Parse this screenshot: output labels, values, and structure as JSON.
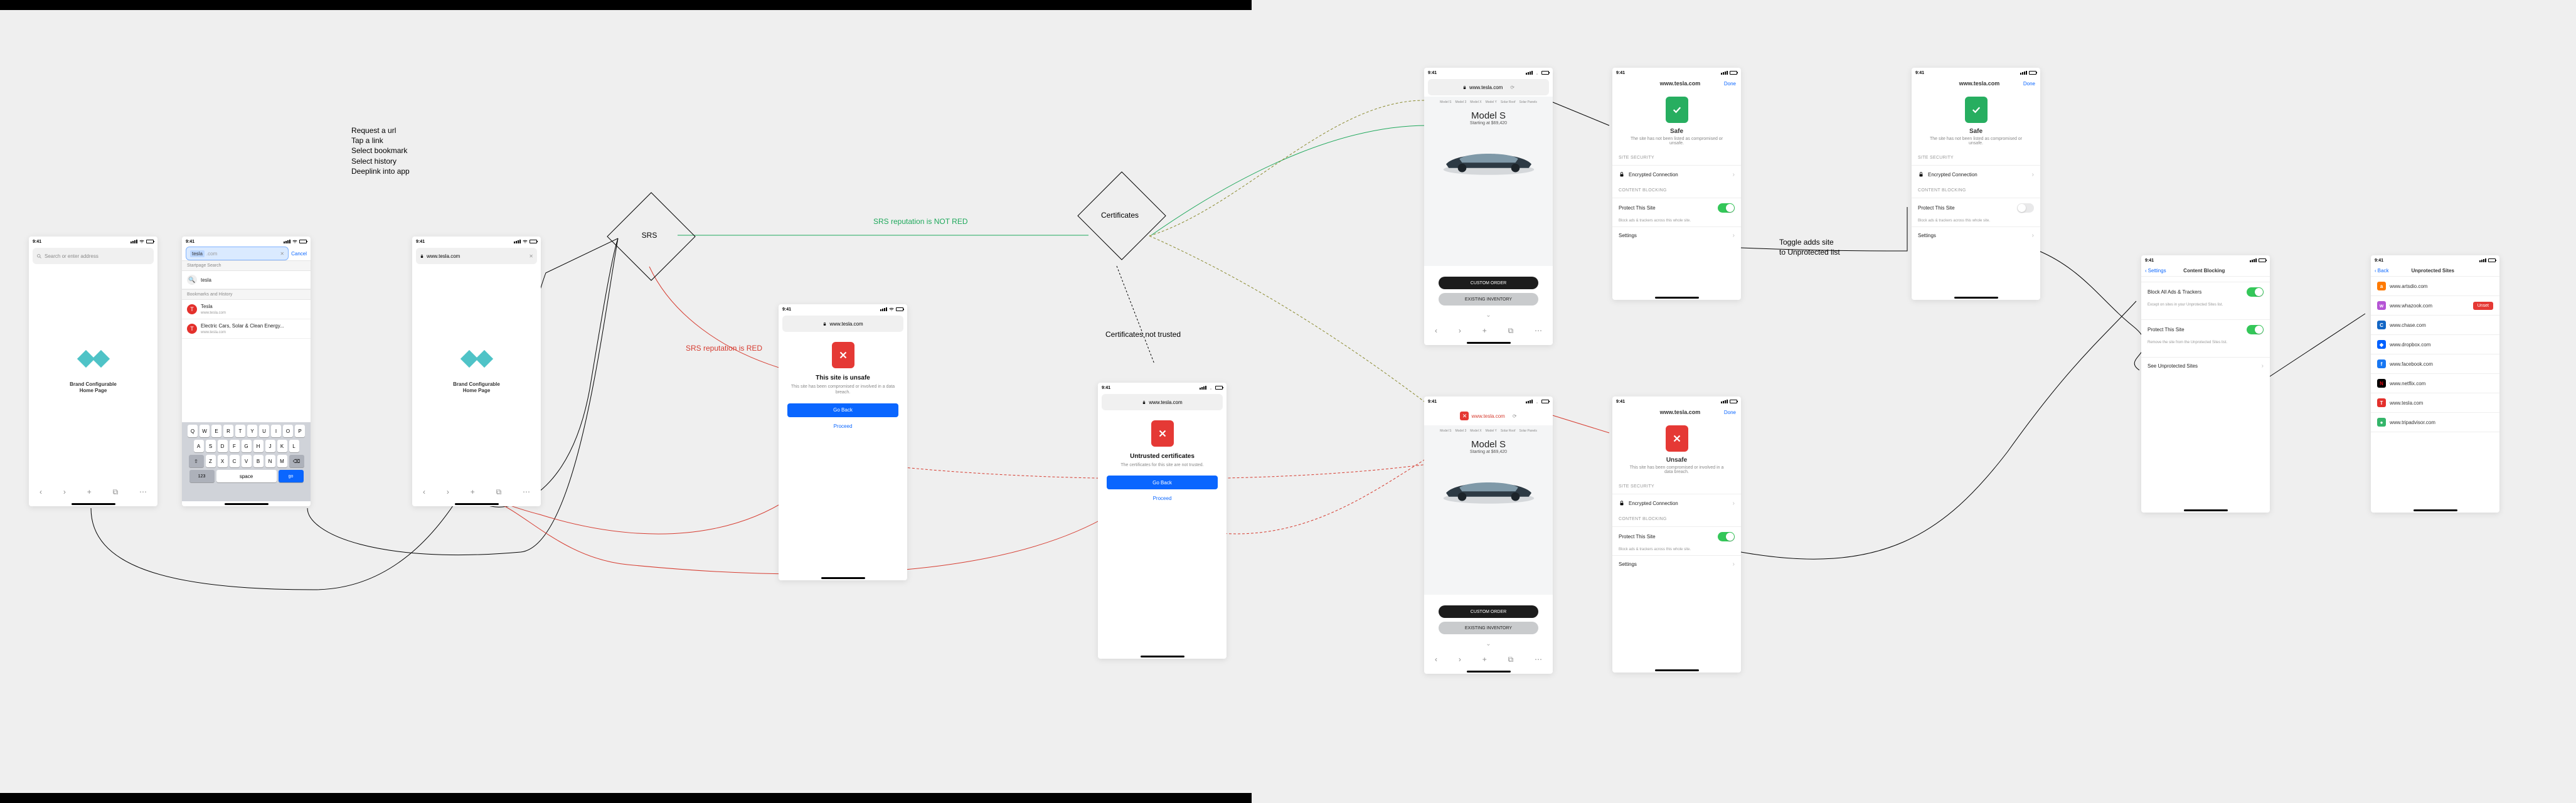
{
  "statusbar": {
    "time": "9:41"
  },
  "url_placeholder": "Search or enter address",
  "url_tesla": "www.tesla.com",
  "url_red_tesla": "www.tesla.com",
  "home_caption_line1": "Brand Configurable",
  "home_caption_line2": "Home Page",
  "toolbar": {
    "back": "‹",
    "forward": "›",
    "plus": "+",
    "tabs": "⧉",
    "more": "⋯"
  },
  "note_actions_1": "Request a url",
  "note_actions_2": "Tap a link",
  "note_actions_3": "Select bookmark",
  "note_actions_4": "Select history",
  "note_actions_5": "Deeplink into app",
  "cancel_label": "Cancel",
  "typed_query": "tesla",
  "suggest": {
    "sect1": "Startpage Search",
    "r1": "tesla",
    "sect2": "Bookmarks and History",
    "r2": "Tesla",
    "r2sub": "www.tesla.com",
    "r3": "Electric Cars, Solar & Clean Energy...",
    "r3sub": "www.tesla.com"
  },
  "keyboard": {
    "row1": [
      "Q",
      "W",
      "E",
      "R",
      "T",
      "Y",
      "U",
      "I",
      "O",
      "P"
    ],
    "row2": [
      "A",
      "S",
      "D",
      "F",
      "G",
      "H",
      "J",
      "K",
      "L"
    ],
    "row3": [
      "Z",
      "X",
      "C",
      "V",
      "B",
      "N",
      "M"
    ],
    "shift": "⇧",
    "del": "⌫",
    "num": "123",
    "space": "space",
    "go": "go"
  },
  "srs_label": "SRS",
  "srs_green": "SRS reputation is NOT RED",
  "srs_red": "SRS reputation is RED",
  "cert_label": "Certificates",
  "cert_not_trusted": "Certificates not trusted",
  "unsafe_title": "This site is unsafe",
  "unsafe_sub": "This site has been compromised or involved in a data breach.",
  "go_back": "Go Back",
  "proceed": "Proceed",
  "untrusted_title": "Untrusted certificates",
  "untrusted_sub": "The certificates for this site are not trusted.",
  "carpage": {
    "tabs": [
      "Model S",
      "Model 3",
      "Model X",
      "Model Y",
      "Solar Roof",
      "Solar Panels"
    ],
    "title": "Model S",
    "subtitle": "Starting at $69,420",
    "cta1": "CUSTOM ORDER",
    "cta2": "EXISTING INVENTORY"
  },
  "panel": {
    "done": "Done",
    "safe_title": "Safe",
    "safe_sub": "The site has not been listed as compromised or unsafe.",
    "unsafe_title": "Unsafe",
    "unsafe_sub": "This site has been compromised or involved in a data breach.",
    "sect_site": "SITE SECURITY",
    "encrypted": "Encrypted Connection",
    "sect_cb": "CONTENT BLOCKING",
    "protect": "Protect This Site",
    "protect_sub": "Block ads & trackers across this whole site.",
    "settings": "Settings"
  },
  "toggle_note_1": "Toggle adds site",
  "toggle_note_2": "to Unprotected list",
  "settings_back": "Settings",
  "settings_title": "Content Blocking",
  "settings_block_all": "Block All Ads & Trackers",
  "settings_block_sub": "Except on sites in your Unprotected Sites list.",
  "settings_protect_this": "Protect This Site",
  "settings_protect_sub": "Remove the site from the Unprotected Sites list.",
  "settings_see_list": "See Unprotected Sites",
  "unprot_back": "Back",
  "unprot_title": "Unprotected Sites",
  "unprot_unset": "Unset",
  "sites": {
    "s1": "www.artsdio.com",
    "s2": "www.whazook.com",
    "s3": "www.chase.com",
    "s4": "www.dropbox.com",
    "s5": "www.facebook.com",
    "s6": "www.netflix.com",
    "s7": "www.tesla.com",
    "s8": "www.tripadvisor.com"
  }
}
